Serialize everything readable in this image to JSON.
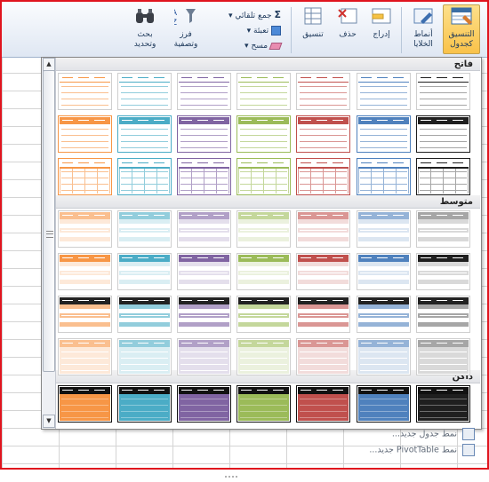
{
  "ribbon": {
    "format_as_table": "التنسيق\nكجدول",
    "cell_styles": "أنماط\nالخلايا",
    "insert": "إدراج",
    "delete": "حذف",
    "format": "تنسيق",
    "autosum": "جمع تلقائي",
    "fill": "تعبئة",
    "clear": "مسح",
    "sort_filter": "فرز\nوتصفية",
    "find_select": "بحث\nوتحديد",
    "dropdown_mark": "▾"
  },
  "gallery": {
    "sections": {
      "light": "فاتح",
      "medium": "متوسط",
      "dark": "داكن"
    },
    "footer": {
      "new_table_style": "نمط جدول جديد...",
      "new_pivot_style": "نمط PivotTable جديد..."
    },
    "scroll_up": "▲",
    "scroll_down": "▼"
  },
  "palette": [
    "#1f1f1f",
    "#4f81bd",
    "#c0504d",
    "#9bbb59",
    "#8064a2",
    "#4bacc6",
    "#f79646"
  ],
  "palette_light": [
    "#d9d9d9",
    "#dce6f1",
    "#f2dcdb",
    "#ebf1de",
    "#e4dfec",
    "#daeef3",
    "#fde9d9"
  ],
  "palette_mid": [
    "#a6a6a6",
    "#95b3d7",
    "#da9694",
    "#c4d79b",
    "#b1a0c7",
    "#92cddc",
    "#fabf8f"
  ],
  "style_rows": {
    "light": [
      "lines",
      "filled-header",
      "grid"
    ],
    "medium": [
      "banded",
      "header-banded",
      "header-banded-dark",
      "soft"
    ],
    "dark": [
      "dark"
    ]
  }
}
